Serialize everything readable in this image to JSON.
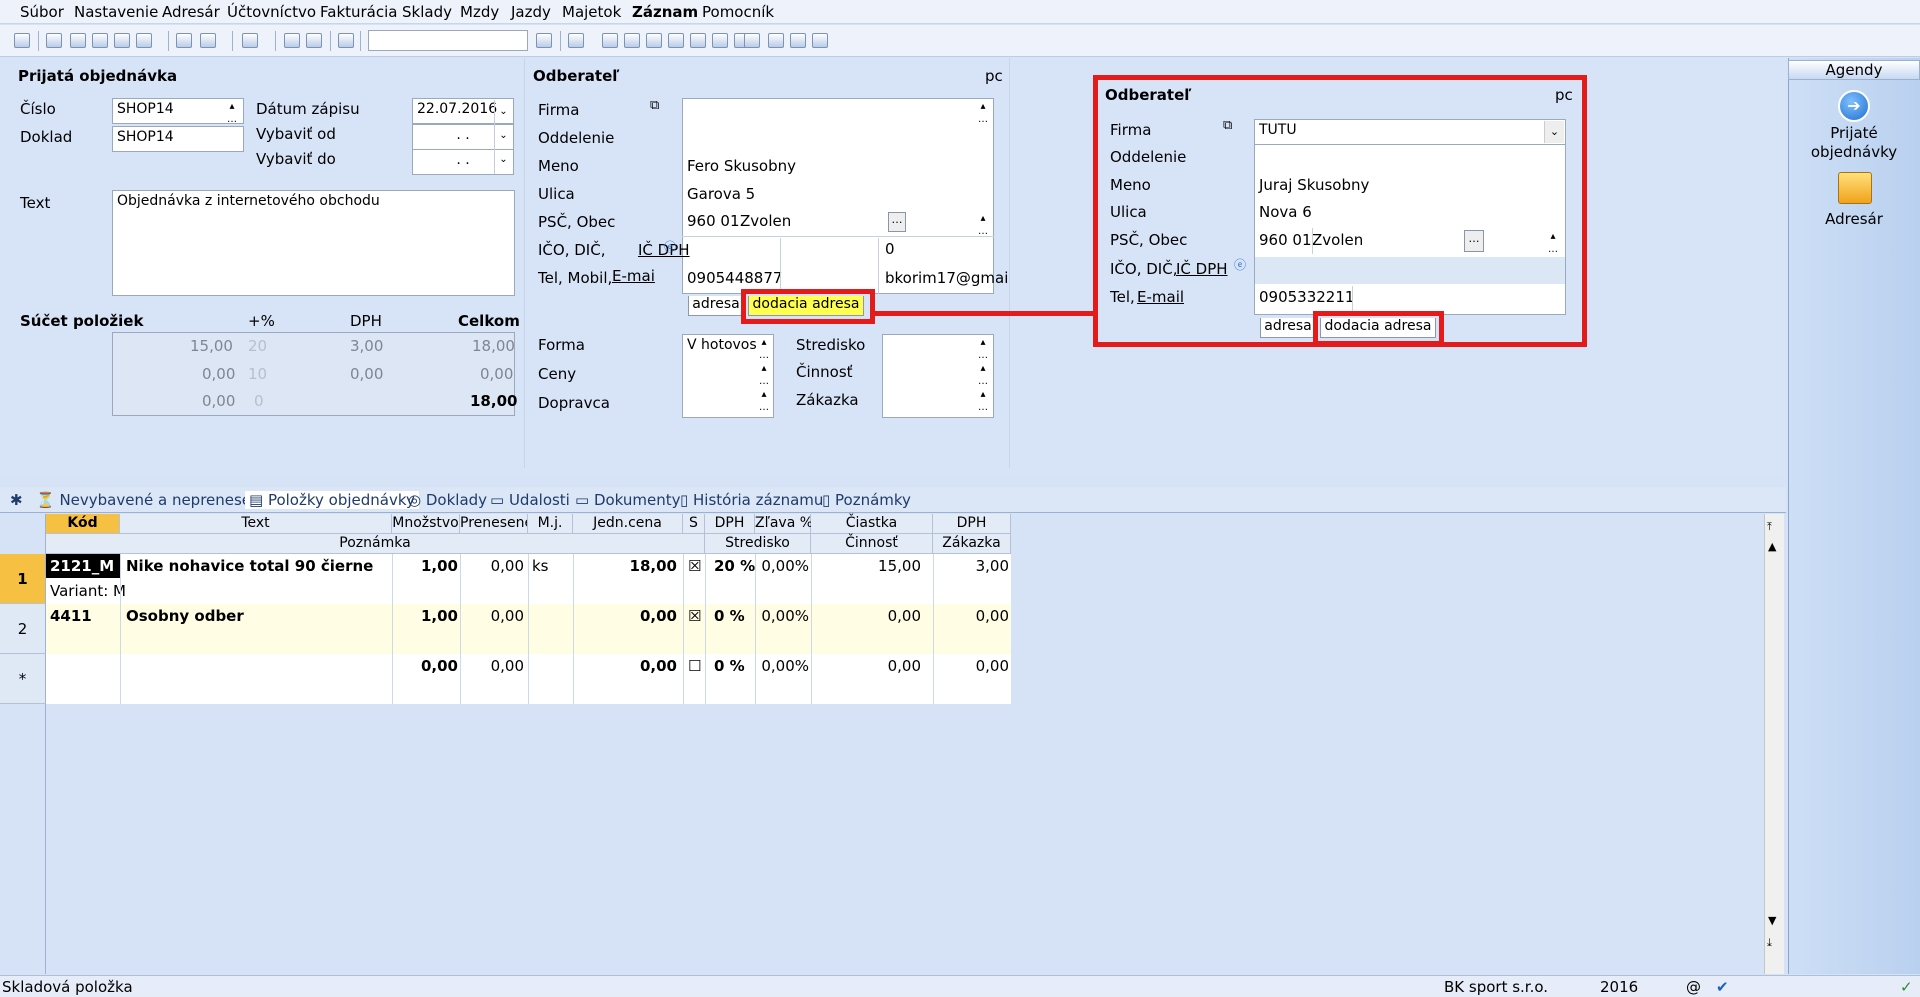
{
  "menu": [
    "Súbor",
    "Nastavenie",
    "Adresár",
    "Účtovníctvo",
    "Fakturácia",
    "Sklady",
    "Mzdy",
    "Jazdy",
    "Majetok",
    "Záznam",
    "Pomocník"
  ],
  "order": {
    "title": "Prijatá objednávka",
    "cislo_label": "Číslo",
    "cislo": "SHOP14",
    "doklad_label": "Doklad",
    "doklad": "SHOP14",
    "datum_label": "Dátum zápisu",
    "datum": "22.07.2016",
    "vybavit_od_label": "Vybaviť od",
    "vybavit_od": ". .",
    "vybavit_do_label": "Vybaviť do",
    "vybavit_do": ". .",
    "text_label": "Text",
    "text": "Objednávka z internetového obchodu"
  },
  "sums": {
    "title": "Súčet položiek",
    "headers": [
      "+%",
      "DPH",
      "Celkom"
    ],
    "rows": [
      {
        "base": "15,00",
        "pct": "20",
        "dph": "3,00",
        "total": "18,00"
      },
      {
        "base": "0,00",
        "pct": "10",
        "dph": "0,00",
        "total": "0,00"
      },
      {
        "base": "0,00",
        "pct": "0",
        "dph": "",
        "total": "18,00"
      }
    ]
  },
  "customer": {
    "title": "Odberateľ",
    "pc": "pc",
    "labels": {
      "firma": "Firma",
      "oddelenie": "Oddelenie",
      "meno": "Meno",
      "ulica": "Ulica",
      "psc": "PSČ, Obec",
      "ico": "IČO, DIČ,",
      "icdph": "IČ DPH",
      "tel": "Tel, Mobil,",
      "email": "E-mai"
    },
    "meno": "Fero Skusobny",
    "ulica": "Garova 5",
    "psc": "960 01",
    "obec": "Zvolen",
    "ico_val": "0",
    "tel": "0905448877",
    "email": "bkorim17@gmai",
    "tab_adresa": "adresa",
    "tab_dodacia": "dodacia adresa",
    "forma_label": "Forma",
    "forma": "V hotovos",
    "ceny_label": "Ceny",
    "dopravca_label": "Dopravca",
    "stredisko_label": "Stredisko",
    "cinnost_label": "Činnosť",
    "zakazka_label": "Zákazka"
  },
  "zoom": {
    "title": "Odberateľ",
    "pc": "pc",
    "labels": {
      "firma": "Firma",
      "oddelenie": "Oddelenie",
      "meno": "Meno",
      "ulica": "Ulica",
      "psc": "PSČ, Obec",
      "ico": "IČO, DIČ,",
      "icdph": "IČ DPH",
      "tel": "Tel,",
      "email": "E-mail"
    },
    "firma": "TUTU",
    "meno": "Juraj Skusobny",
    "ulica": "Nova 6",
    "psc": "960 01",
    "obec": "Zvolen",
    "tel": "0905332211",
    "tab_adresa": "adresa",
    "tab_dodacia": "dodacia adresa"
  },
  "agendy": {
    "title": "Agendy",
    "item1": "Prijaté objednávky",
    "item2": "Adresár"
  },
  "tabs": [
    "Nevybavené a neprenesené",
    "Položky objednávky",
    "Doklady",
    "Udalosti",
    "Dokumenty",
    "História záznamu",
    "Poznámky"
  ],
  "grid": {
    "headers1": [
      "Kód",
      "Text",
      "Množstvo",
      "Prenesené",
      "M.j.",
      "Jedn.cena",
      "S",
      "DPH",
      "Zľava %",
      "Čiastka",
      "DPH"
    ],
    "headers2": [
      "Poznámka",
      "Stredisko",
      "Činnosť",
      "Zákazka"
    ],
    "rows": [
      {
        "n": "1",
        "kod": "2121_M",
        "text": "Nike nohavice total 90 čierne",
        "mnoz": "1,00",
        "pren": "0,00",
        "mj": "ks",
        "cena": "18,00",
        "s": "☒",
        "dph": "20 %",
        "zlava": "0,00%",
        "ciastka": "15,00",
        "dphv": "3,00",
        "pozn": "Variant: M"
      },
      {
        "n": "2",
        "kod": "4411",
        "text": "Osobny odber",
        "mnoz": "1,00",
        "pren": "0,00",
        "mj": "",
        "cena": "0,00",
        "s": "☒",
        "dph": "0 %",
        "zlava": "0,00%",
        "ciastka": "0,00",
        "dphv": "0,00",
        "pozn": ""
      },
      {
        "n": "*",
        "kod": "",
        "text": "",
        "mnoz": "0,00",
        "pren": "0,00",
        "mj": "",
        "cena": "0,00",
        "s": "☐",
        "dph": "0 %",
        "zlava": "0,00%",
        "ciastka": "0,00",
        "dphv": "0,00",
        "pozn": ""
      }
    ]
  },
  "status": {
    "left": "Skladová položka",
    "company": "BK sport  s.r.o.",
    "year": "2016",
    "at": "@"
  }
}
